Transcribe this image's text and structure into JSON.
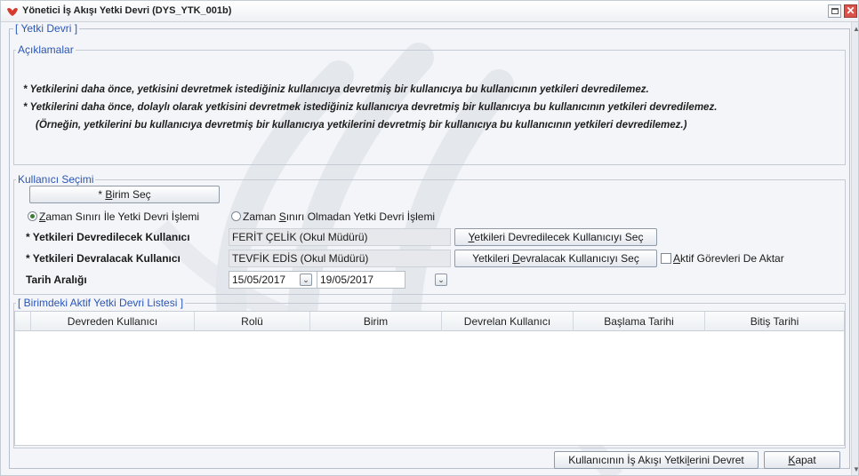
{
  "window": {
    "title": "Yönetici İş Akışı Yetki Devri (DYS_YTK_001b)"
  },
  "main_group": {
    "legend": "[ Yetki Devri ]"
  },
  "description": {
    "legend": "Açıklamalar",
    "lines": [
      "* Yetkilerini daha önce, yetkisini devretmek istediğiniz kullanıcıya devretmiş bir kullanıcıya bu kullanıcının yetkileri devredilemez.",
      "* Yetkilerini daha önce, dolaylı olarak yetkisini devretmek istediğiniz kullanıcıya devretmiş bir kullanıcıya bu kullanıcının yetkileri devredilemez.",
      "(Örneğin, yetkilerini bu kullanıcıya devretmiş bir kullanıcıya yetkilerini devretmiş bir kullanıcıya bu kullanıcının yetkileri devredilemez.)"
    ]
  },
  "user_selection": {
    "legend": "Kullanıcı Seçimi",
    "select_unit_button": {
      "prefix": "* ",
      "mnemonic": "B",
      "rest": "irim Seç"
    },
    "radio_time_limited": {
      "mnemonic": "Z",
      "rest": "aman Sınırı İle Yetki Devri İşlemi",
      "checked": true
    },
    "radio_no_time_limit": {
      "before": "Zaman ",
      "mnemonic": "S",
      "rest": "ınırı Olmadan Yetki Devri İşlemi",
      "checked": false
    },
    "from_user": {
      "label": "* Yetkileri Devredilecek Kullanıcı",
      "value": "FERİT ÇELİK (Okul Müdürü)",
      "button": {
        "mnemonic": "Y",
        "rest": "etkileri Devredilecek Kullanıcıyı Seç"
      }
    },
    "to_user": {
      "label": "* Yetkileri Devralacak Kullanıcı",
      "value": "TEVFİK EDİS (Okul Müdürü)",
      "button": {
        "before": "Yetkileri ",
        "mnemonic": "D",
        "rest": "evralacak Kullanıcıyı Seç"
      }
    },
    "transfer_active_tasks": {
      "mnemonic": "A",
      "rest": "ktif Görevleri De Aktar",
      "checked": false
    },
    "date_range": {
      "label": "Tarih Aralığı",
      "start": "15/05/2017",
      "end": "19/05/2017"
    }
  },
  "active_list": {
    "legend": "[ Birimdeki Aktif Yetki Devri Listesi ]",
    "columns": [
      "Devreden Kullanıcı",
      "Rolü",
      "Birim",
      "Devrelan Kullanıcı",
      "Başlama Tarihi",
      "Bitiş Tarihi"
    ],
    "rows": []
  },
  "footer": {
    "transfer_button": {
      "before": "Kullanıcının İş Akışı Yetki",
      "mnemonic": "l",
      "rest": "erini Devret"
    },
    "close_button": {
      "mnemonic": "K",
      "rest": "apat"
    }
  },
  "colors": {
    "legend_text": "#2a56b8",
    "window_bg": "#f3f5f8",
    "close_button": "#d9534a"
  },
  "icons": [
    "app-icon",
    "restore-icon",
    "close-icon",
    "dropdown-arrow-icon",
    "scroll-up-icon",
    "scroll-down-icon"
  ]
}
